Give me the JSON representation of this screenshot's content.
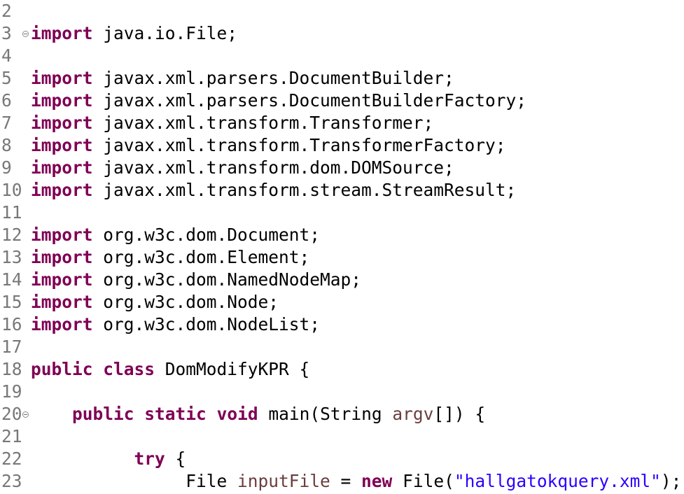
{
  "editor": {
    "lines": [
      {
        "num": "2",
        "fold": false,
        "tokens": []
      },
      {
        "num": "3",
        "fold": true,
        "tokens": [
          {
            "t": "kw",
            "v": "import"
          },
          {
            "t": "plain",
            "v": " java.io.File;"
          }
        ]
      },
      {
        "num": "4",
        "fold": false,
        "tokens": []
      },
      {
        "num": "5",
        "fold": false,
        "tokens": [
          {
            "t": "kw",
            "v": "import"
          },
          {
            "t": "plain",
            "v": " javax.xml.parsers.DocumentBuilder;"
          }
        ]
      },
      {
        "num": "6",
        "fold": false,
        "tokens": [
          {
            "t": "kw",
            "v": "import"
          },
          {
            "t": "plain",
            "v": " javax.xml.parsers.DocumentBuilderFactory;"
          }
        ]
      },
      {
        "num": "7",
        "fold": false,
        "tokens": [
          {
            "t": "kw",
            "v": "import"
          },
          {
            "t": "plain",
            "v": " javax.xml.transform.Transformer;"
          }
        ]
      },
      {
        "num": "8",
        "fold": false,
        "tokens": [
          {
            "t": "kw",
            "v": "import"
          },
          {
            "t": "plain",
            "v": " javax.xml.transform.TransformerFactory;"
          }
        ]
      },
      {
        "num": "9",
        "fold": false,
        "tokens": [
          {
            "t": "kw",
            "v": "import"
          },
          {
            "t": "plain",
            "v": " javax.xml.transform.dom.DOMSource;"
          }
        ]
      },
      {
        "num": "10",
        "fold": false,
        "tokens": [
          {
            "t": "kw",
            "v": "import"
          },
          {
            "t": "plain",
            "v": " javax.xml.transform.stream.StreamResult;"
          }
        ]
      },
      {
        "num": "11",
        "fold": false,
        "tokens": []
      },
      {
        "num": "12",
        "fold": false,
        "tokens": [
          {
            "t": "kw",
            "v": "import"
          },
          {
            "t": "plain",
            "v": " org.w3c.dom.Document;"
          }
        ]
      },
      {
        "num": "13",
        "fold": false,
        "tokens": [
          {
            "t": "kw",
            "v": "import"
          },
          {
            "t": "plain",
            "v": " org.w3c.dom.Element;"
          }
        ]
      },
      {
        "num": "14",
        "fold": false,
        "tokens": [
          {
            "t": "kw",
            "v": "import"
          },
          {
            "t": "plain",
            "v": " org.w3c.dom.NamedNodeMap;"
          }
        ]
      },
      {
        "num": "15",
        "fold": false,
        "tokens": [
          {
            "t": "kw",
            "v": "import"
          },
          {
            "t": "plain",
            "v": " org.w3c.dom.Node;"
          }
        ]
      },
      {
        "num": "16",
        "fold": false,
        "tokens": [
          {
            "t": "kw",
            "v": "import"
          },
          {
            "t": "plain",
            "v": " org.w3c.dom.NodeList;"
          }
        ]
      },
      {
        "num": "17",
        "fold": false,
        "tokens": []
      },
      {
        "num": "18",
        "fold": false,
        "tokens": [
          {
            "t": "kw",
            "v": "public"
          },
          {
            "t": "plain",
            "v": " "
          },
          {
            "t": "kw",
            "v": "class"
          },
          {
            "t": "plain",
            "v": " DomModifyKPR {"
          }
        ]
      },
      {
        "num": "19",
        "fold": false,
        "tokens": []
      },
      {
        "num": "20",
        "fold": true,
        "tokens": [
          {
            "t": "plain",
            "v": "    "
          },
          {
            "t": "kw",
            "v": "public"
          },
          {
            "t": "plain",
            "v": " "
          },
          {
            "t": "kw",
            "v": "static"
          },
          {
            "t": "plain",
            "v": " "
          },
          {
            "t": "kw",
            "v": "void"
          },
          {
            "t": "plain",
            "v": " main(String "
          },
          {
            "t": "var",
            "v": "argv"
          },
          {
            "t": "plain",
            "v": "[]) {"
          }
        ]
      },
      {
        "num": "21",
        "fold": false,
        "tokens": []
      },
      {
        "num": "22",
        "fold": false,
        "tokens": [
          {
            "t": "plain",
            "v": "          "
          },
          {
            "t": "kw",
            "v": "try"
          },
          {
            "t": "plain",
            "v": " {"
          }
        ]
      },
      {
        "num": "23",
        "fold": false,
        "tokens": [
          {
            "t": "plain",
            "v": "               File "
          },
          {
            "t": "var",
            "v": "inputFile"
          },
          {
            "t": "plain",
            "v": " = "
          },
          {
            "t": "kw",
            "v": "new"
          },
          {
            "t": "plain",
            "v": " File("
          },
          {
            "t": "str",
            "v": "\"hallgatokquery.xml\""
          },
          {
            "t": "plain",
            "v": ");"
          }
        ]
      }
    ]
  },
  "colors": {
    "keyword": "#7f0055",
    "variable": "#6a3e3e",
    "string": "#2a00ff",
    "line_number": "#787878",
    "text": "#000000",
    "background": "#ffffff"
  }
}
